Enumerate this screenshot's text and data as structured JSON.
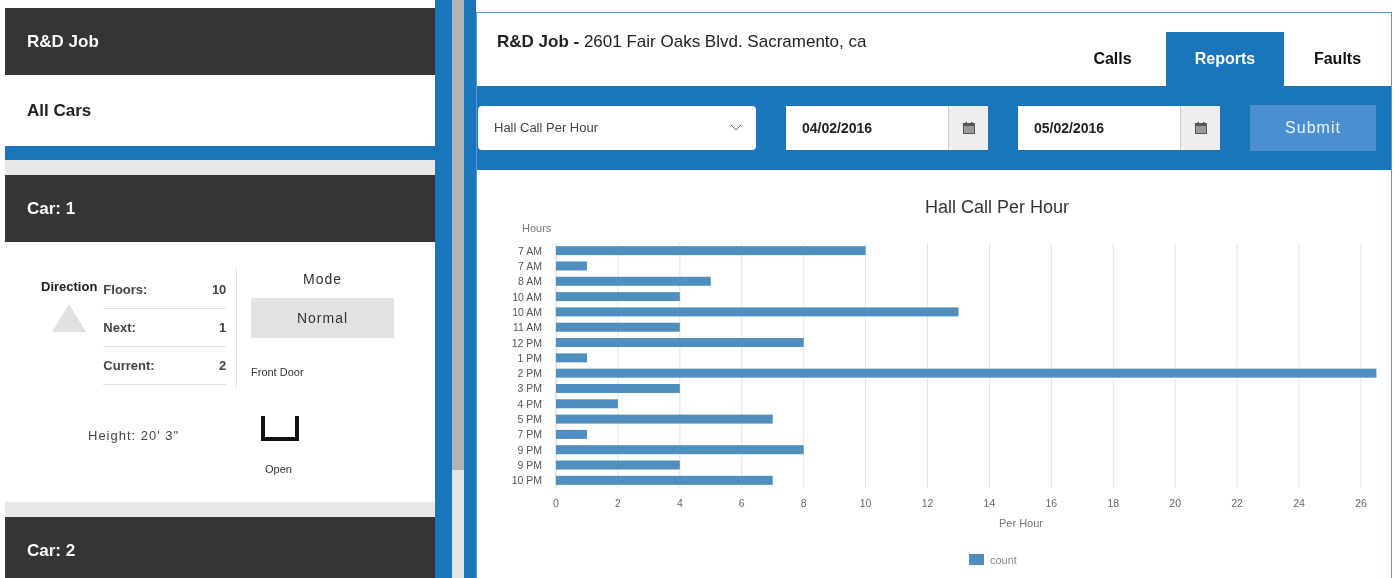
{
  "sidebar": {
    "job_title": "R&D Job",
    "all_cars": "All Cars",
    "cars": [
      {
        "title": "Car: 1",
        "expanded": true,
        "direction_label": "Direction",
        "stats": [
          {
            "label": "Floors:",
            "value": "10"
          },
          {
            "label": "Next:",
            "value": "1"
          },
          {
            "label": "Current:",
            "value": "2"
          }
        ],
        "height": "Height: 20' 3\"",
        "mode_label": "Mode",
        "mode": "Normal",
        "door_label": "Front Door",
        "door_status": "Open"
      },
      {
        "title": "Car: 2",
        "expanded": false
      }
    ]
  },
  "header": {
    "job": "R&D Job -",
    "address": "2601 Fair Oaks Blvd. Sacramento, ca"
  },
  "tabs": [
    {
      "label": "Calls",
      "selected": false
    },
    {
      "label": "Reports",
      "selected": true
    },
    {
      "label": "Faults",
      "selected": false
    }
  ],
  "filters": {
    "report": "Hall Call Per Hour",
    "start_date": "04/02/2016",
    "end_date": "05/02/2016",
    "submit": "Submit"
  },
  "chart": {
    "chart_data": {
      "type": "bar",
      "orientation": "horizontal",
      "title": "Hall Call Per Hour",
      "xlabel": "Per Hour",
      "ylabel": "Hours",
      "categories": [
        "7 AM",
        "7 AM",
        "8 AM",
        "10 AM",
        "10 AM",
        "11 AM",
        "12 PM",
        "1 PM",
        "2 PM",
        "3 PM",
        "4 PM",
        "5 PM",
        "7 PM",
        "9 PM",
        "9 PM",
        "10 PM"
      ],
      "series": [
        {
          "name": "count",
          "color": "#4f8fc0",
          "values": [
            10,
            1,
            5,
            4,
            13,
            4,
            8,
            1,
            26.5,
            4,
            2,
            7,
            1,
            8,
            4,
            7
          ]
        }
      ],
      "grid": true,
      "xlim": [
        0,
        26.55
      ],
      "xticks": [
        0,
        2,
        4,
        6,
        8,
        10,
        12,
        14,
        16,
        18,
        20,
        22,
        24,
        26
      ]
    }
  }
}
